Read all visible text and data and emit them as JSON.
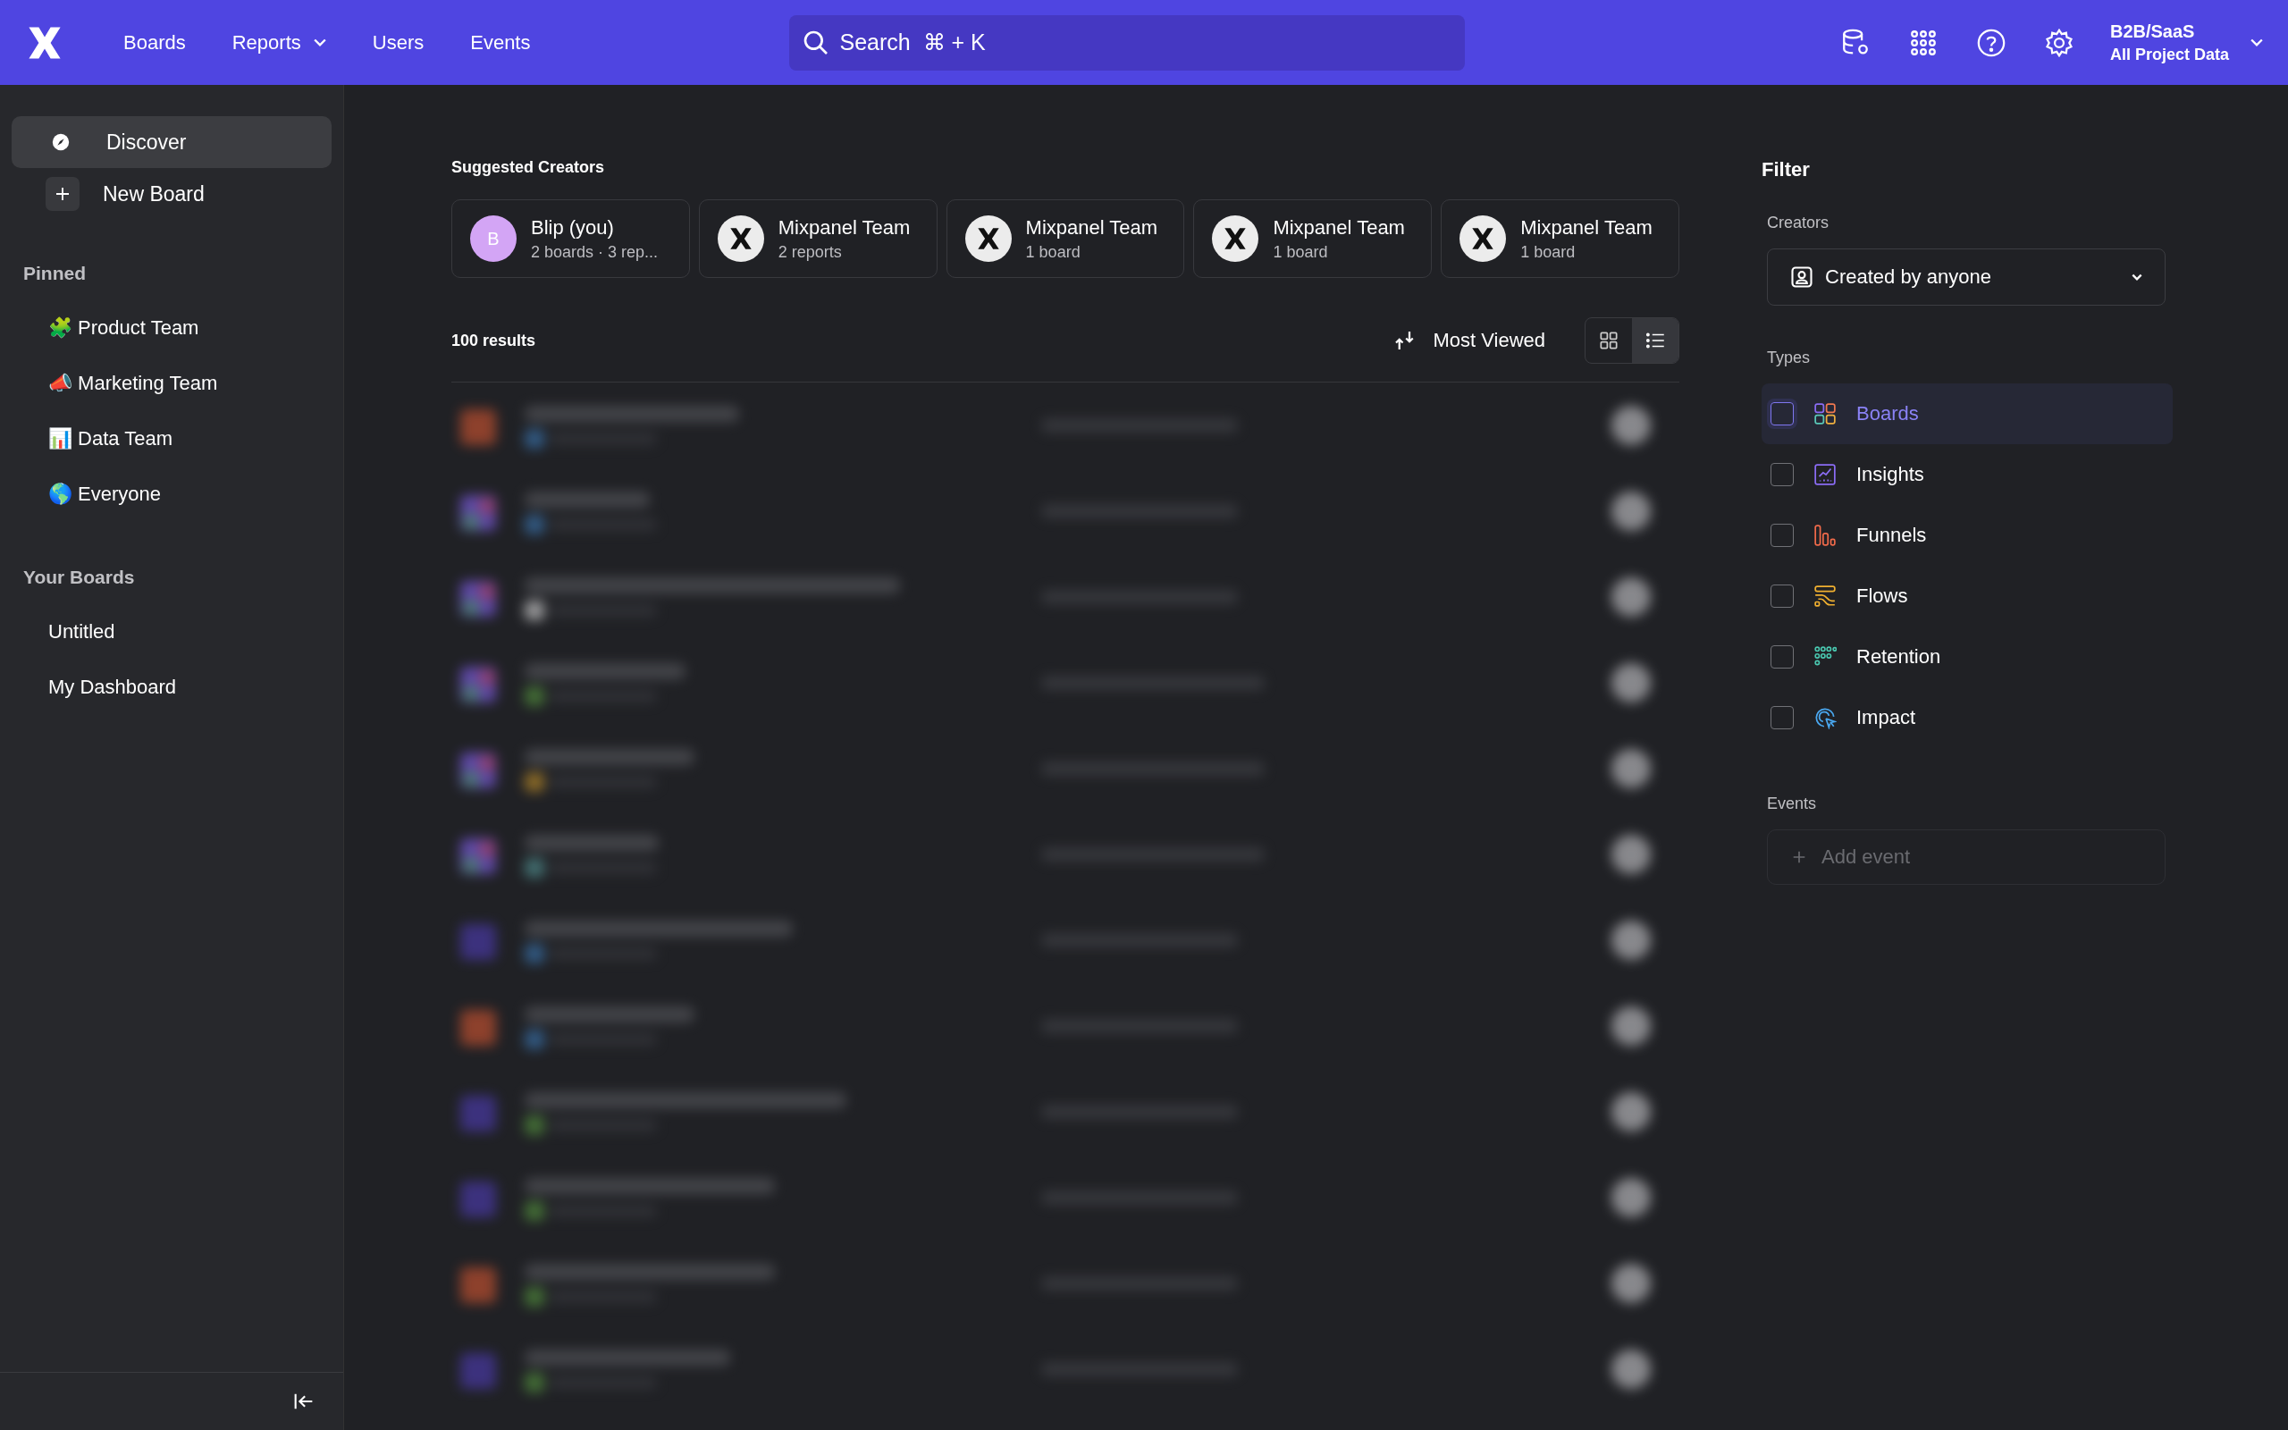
{
  "top_nav": {
    "items": [
      {
        "label": "Boards",
        "dropdown": false
      },
      {
        "label": "Reports",
        "dropdown": true
      },
      {
        "label": "Users",
        "dropdown": false
      },
      {
        "label": "Events",
        "dropdown": false
      }
    ],
    "search": {
      "placeholder": "Search  ⌘ + K"
    },
    "project": {
      "name": "B2B/SaaS",
      "scope": "All Project Data"
    }
  },
  "sidebar": {
    "items": [
      {
        "label": "Discover",
        "kind": "discover",
        "selected": true
      },
      {
        "label": "New Board",
        "kind": "new",
        "selected": false
      }
    ],
    "sections": [
      {
        "title": "Pinned",
        "items": [
          {
            "label": "🧩 Product Team"
          },
          {
            "label": "📣 Marketing Team"
          },
          {
            "label": "📊 Data Team"
          },
          {
            "label": "🌎 Everyone"
          }
        ]
      },
      {
        "title": "Your Boards",
        "items": [
          {
            "label": "Untitled"
          },
          {
            "label": "My Dashboard"
          }
        ]
      }
    ]
  },
  "suggested_creators": {
    "title": "Suggested Creators",
    "items": [
      {
        "name": "Blip (you)",
        "detail": "2 boards · 3 rep...",
        "kind": "letter",
        "initial": "B"
      },
      {
        "name": "Mixpanel Team",
        "detail": "2 reports",
        "kind": "logo"
      },
      {
        "name": "Mixpanel Team",
        "detail": "1 board",
        "kind": "logo"
      },
      {
        "name": "Mixpanel Team",
        "detail": "1 board",
        "kind": "logo"
      },
      {
        "name": "Mixpanel Team",
        "detail": "1 board",
        "kind": "logo"
      }
    ]
  },
  "results": {
    "count": "100 results",
    "sort": "Most Viewed",
    "views": [
      {
        "kind": "grid",
        "selected": false
      },
      {
        "kind": "list",
        "selected": true
      }
    ],
    "rows": [
      {
        "kind": "funnels"
      },
      {
        "kind": "board"
      },
      {
        "kind": "board"
      },
      {
        "kind": "board"
      },
      {
        "kind": "board"
      },
      {
        "kind": "board"
      },
      {
        "kind": "insights"
      },
      {
        "kind": "funnels"
      },
      {
        "kind": "insights"
      },
      {
        "kind": "insights"
      },
      {
        "kind": "funnels"
      },
      {
        "kind": "insights"
      }
    ]
  },
  "filter": {
    "title": "Filter",
    "creators_label": "Creators",
    "creators_value": "Created by anyone",
    "types_label": "Types",
    "types": [
      {
        "label": "Boards",
        "kind": "boards",
        "checked": false,
        "selected": true
      },
      {
        "label": "Insights",
        "kind": "insights",
        "checked": false,
        "selected": false
      },
      {
        "label": "Funnels",
        "kind": "funnels",
        "checked": false,
        "selected": false
      },
      {
        "label": "Flows",
        "kind": "flows",
        "checked": false,
        "selected": false
      },
      {
        "label": "Retention",
        "kind": "retention",
        "checked": false,
        "selected": false
      },
      {
        "label": "Impact",
        "kind": "impact",
        "checked": false,
        "selected": false
      }
    ],
    "events_label": "Events",
    "events_placeholder": "Add event"
  }
}
